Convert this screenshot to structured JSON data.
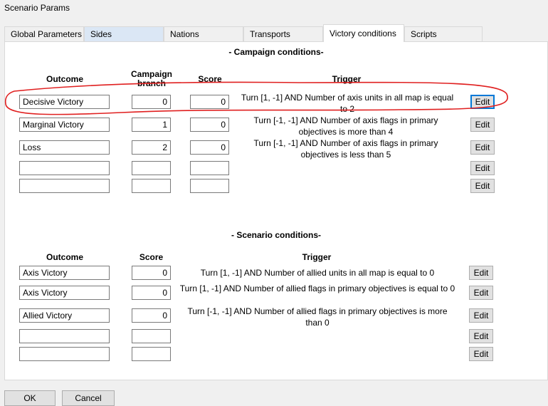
{
  "window": {
    "title": "Scenario Params"
  },
  "tabs": [
    {
      "label": "Global Parameters"
    },
    {
      "label": "Sides"
    },
    {
      "label": "Nations"
    },
    {
      "label": "Transports"
    },
    {
      "label": "Victory conditions"
    },
    {
      "label": "Scripts"
    }
  ],
  "campaign": {
    "title": "- Campaign conditions-",
    "headers": {
      "outcome": "Outcome",
      "branch": "Campaign branch",
      "score": "Score",
      "trigger": "Trigger"
    },
    "rows": [
      {
        "outcome": "Decisive Victory",
        "branch": "0",
        "score": "0",
        "trigger": "Turn [1, -1] AND Number of axis units in all map is equal to 2",
        "edit": "Edit"
      },
      {
        "outcome": "Marginal Victory",
        "branch": "1",
        "score": "0",
        "trigger": "Turn [-1, -1] AND Number of axis flags in primary objectives is more than 4",
        "edit": "Edit"
      },
      {
        "outcome": "Loss",
        "branch": "2",
        "score": "0",
        "trigger": "Turn [-1, -1] AND Number of axis flags in primary objectives is less than 5",
        "edit": "Edit"
      },
      {
        "outcome": "",
        "branch": "",
        "score": "",
        "trigger": "",
        "edit": "Edit"
      },
      {
        "outcome": "",
        "branch": "",
        "score": "",
        "trigger": "",
        "edit": "Edit"
      }
    ]
  },
  "scenario": {
    "title": "- Scenario conditions-",
    "headers": {
      "outcome": "Outcome",
      "score": "Score",
      "trigger": "Trigger"
    },
    "rows": [
      {
        "outcome": "Axis Victory",
        "score": "0",
        "trigger": "Turn [1, -1] AND Number of allied units in all map is equal to 0",
        "edit": "Edit"
      },
      {
        "outcome": "Axis Victory",
        "score": "0",
        "trigger": "Turn [1, -1] AND Number of allied flags in primary objectives is equal to 0",
        "edit": "Edit"
      },
      {
        "outcome": "Allied Victory",
        "score": "0",
        "trigger": "Turn [-1, -1] AND Number of allied flags in primary objectives is more than 0",
        "edit": "Edit"
      },
      {
        "outcome": "",
        "score": "",
        "trigger": "",
        "edit": "Edit"
      },
      {
        "outcome": "",
        "score": "",
        "trigger": "",
        "edit": "Edit"
      }
    ]
  },
  "buttons": {
    "ok": "OK",
    "cancel": "Cancel"
  },
  "colors": {
    "annotation": "#e02020",
    "focus": "#0078d7",
    "tab_hover": "#dbe7f5"
  }
}
